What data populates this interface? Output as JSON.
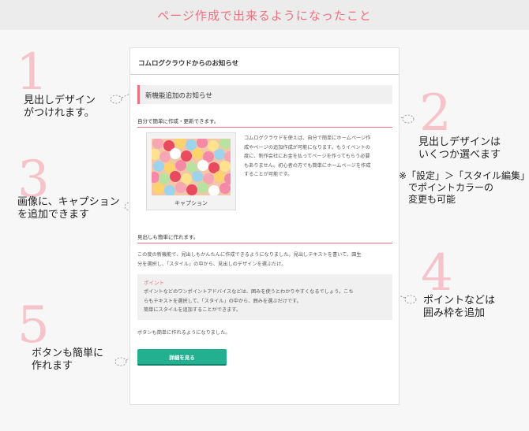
{
  "header": {
    "title": "ページ作成で出来るようになったこと"
  },
  "card": {
    "title": "コムログクラウドからのお知らせ",
    "heading": "新機能追加のお知らせ",
    "section1": "自分で簡単に作成・更新できます。",
    "image_caption": "キャプション",
    "image_text": [
      "コムログクラウドを使えば、自分で簡単にホームページ作",
      "成やページの追加作成が可能になります。もうイベントの",
      "度に、制作会社にお金を払ってページを作ってもらう必要",
      "もありません。初心者の方でも簡単にホームページを作成",
      "することが可能です。"
    ],
    "section2": "見出しも簡単に作れます。",
    "para2": [
      "この度の新機能で、見出しもかんたんに作成できるようになりました。見出しテキストを書いて、園生",
      "分を選択し、「スタイル」の中から、見出しのデザインを選ぶだけ。"
    ],
    "point_label": "ポイント",
    "point_text": [
      "ポイントなどのワンポイントアドバイスなどは、囲みを使うとわかりやすくなるでしょう。こち",
      "らもテキストを選択して、「スタイル」の中から、囲みを選ぶだけです。",
      "簡単にスタイルを追加することができます。"
    ],
    "button_intro": "ボタンも簡単に作れるようになりました。",
    "button_label": "詳細を見る"
  },
  "annotations": [
    {
      "num": "1",
      "lines": [
        "見出しデザイン",
        "がつけれます。"
      ]
    },
    {
      "num": "2",
      "lines": [
        "見出しデザインは",
        "いくつか選べます"
      ]
    },
    {
      "num": "3",
      "lines": [
        "画像に、キャプション",
        "を追加できます"
      ]
    },
    {
      "num": "4",
      "lines": [
        "ポイントなどは",
        "囲み枠を追加"
      ]
    },
    {
      "num": "5",
      "lines": [
        "ボタンも簡単に",
        "作れます"
      ]
    }
  ],
  "style_note": [
    "※「設定」＞「スタイル編集」",
    "でポイントカラーの",
    "変更も可能"
  ],
  "colors": {
    "accent": "#f07080",
    "button": "#22b091",
    "number": "#f6c3cb"
  }
}
